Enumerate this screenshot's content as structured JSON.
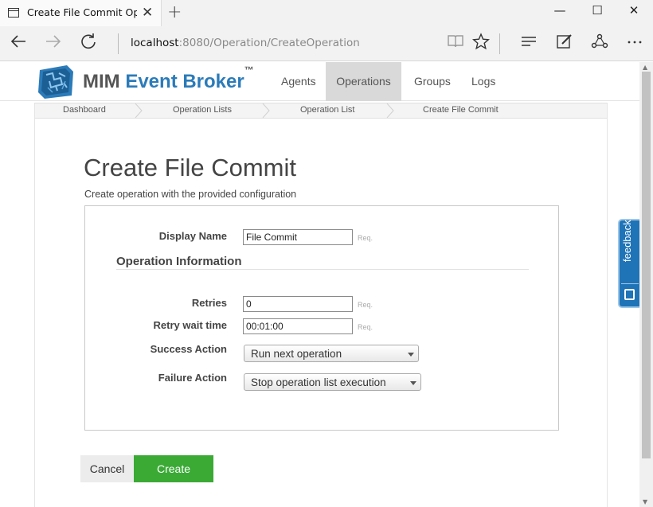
{
  "browser": {
    "tab_title": "Create File Commit Ope",
    "tab_close": "✕",
    "new_tab": "+",
    "window_buttons": {
      "minimize": "—",
      "maximize": "☐",
      "close": "✕"
    },
    "address_host": "localhost",
    "address_rest": ":8080/Operation/CreateOperation",
    "nav_icons": [
      "back-icon",
      "forward-icon",
      "refresh-icon"
    ],
    "toolbar_icons": [
      "reading-view-icon",
      "favorite-star-icon",
      "hub-icon",
      "web-note-icon",
      "share-icon",
      "more-icon"
    ]
  },
  "site": {
    "brand_part1": "MIM ",
    "brand_part2": "Event Broker",
    "brand_tm": "™",
    "menu": [
      "Agents",
      "Operations",
      "Groups",
      "Logs"
    ],
    "active_menu": "Operations"
  },
  "breadcrumb": [
    "Dashboard",
    "Operation Lists",
    "Operation List",
    "Create File Commit"
  ],
  "page": {
    "title": "Create File Commit",
    "subtitle": "Create operation with the provided configuration"
  },
  "form": {
    "display_name_label": "Display Name",
    "display_name_value": "File Commit",
    "req_text": "Req.",
    "section_title": "Operation Information",
    "retries_label": "Retries",
    "retries_value": "0",
    "retry_wait_label": "Retry wait time",
    "retry_wait_value": "00:01:00",
    "success_action_label": "Success Action",
    "success_action_value": "Run next operation",
    "failure_action_label": "Failure Action",
    "failure_action_value": "Stop operation list execution"
  },
  "buttons": {
    "cancel": "Cancel",
    "create": "Create"
  },
  "feedback_label": "feedback",
  "colors": {
    "brand_blue": "#2b7bb9",
    "create_green": "#3aaa35",
    "feedback_blue": "#1f73b7"
  }
}
